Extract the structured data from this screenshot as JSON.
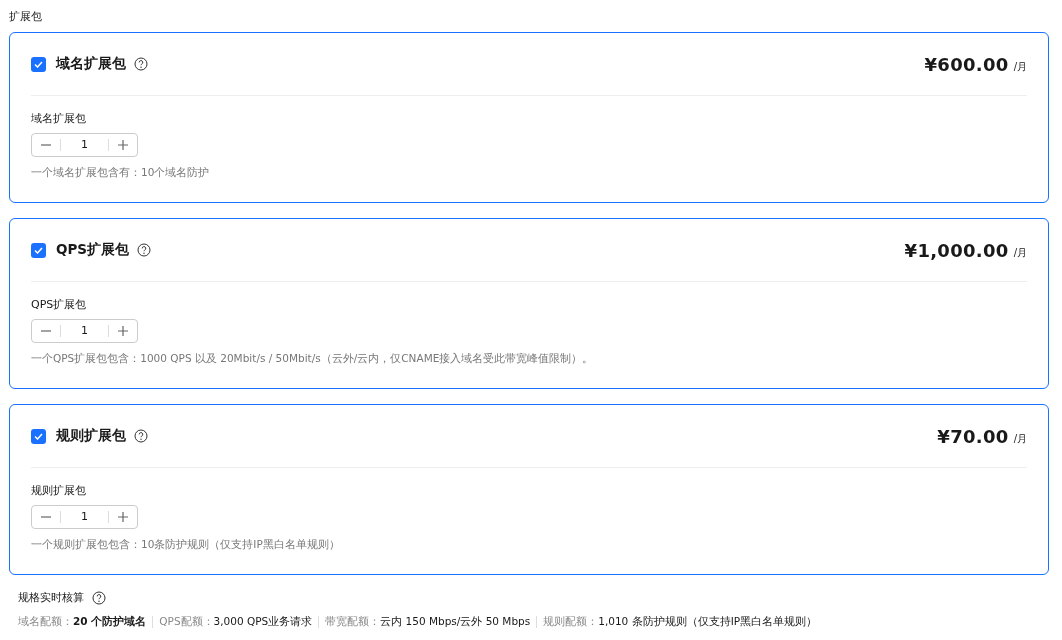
{
  "section_title": "扩展包",
  "packages": [
    {
      "name": "域名扩展包",
      "checked": true,
      "price": "¥600.00",
      "unit": "/月",
      "field_label": "域名扩展包",
      "quantity": "1",
      "description": "一个域名扩展包含有：10个域名防护"
    },
    {
      "name": "QPS扩展包",
      "checked": true,
      "price": "¥1,000.00",
      "unit": "/月",
      "field_label": "QPS扩展包",
      "quantity": "1",
      "description": "一个QPS扩展包包含：1000 QPS 以及 20Mbit/s / 50Mbit/s（云外/云内，仅CNAME接入域名受此带宽峰值限制）。"
    },
    {
      "name": "规则扩展包",
      "checked": true,
      "price": "¥70.00",
      "unit": "/月",
      "field_label": "规则扩展包",
      "quantity": "1",
      "description": "一个规则扩展包包含：10条防护规则（仅支持IP黑白名单规则）"
    }
  ],
  "summary": {
    "title": "规格实时核算",
    "items": [
      {
        "label": "域名配额：",
        "value": "20 个防护域名",
        "value_bold": true
      },
      {
        "label": "QPS配额：",
        "value": "3,000 QPS业务请求",
        "value_bold": false
      },
      {
        "label": "带宽配额：",
        "value": "云内 150 Mbps/云外 50 Mbps",
        "value_bold": false
      },
      {
        "label": "规则配额：",
        "value": "1,010 条防护规则（仅支持IP黑白名单规则）",
        "value_bold": false
      }
    ]
  }
}
